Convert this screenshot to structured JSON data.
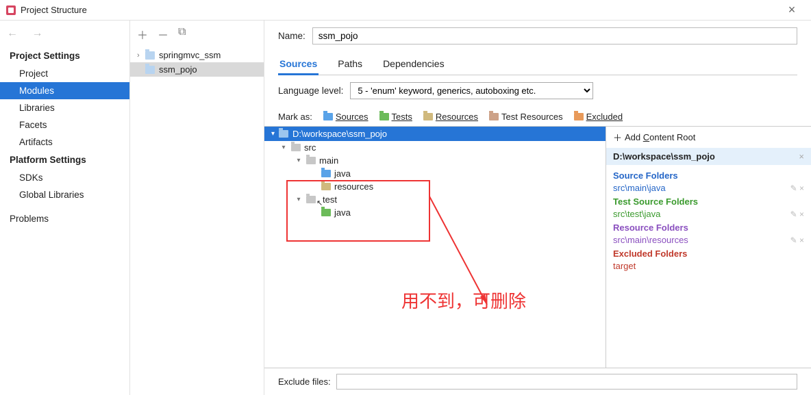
{
  "window": {
    "title": "Project Structure"
  },
  "nav": {
    "project_settings": "Project Settings",
    "items1": [
      "Project",
      "Modules",
      "Libraries",
      "Facets",
      "Artifacts"
    ],
    "platform_settings": "Platform Settings",
    "items2": [
      "SDKs",
      "Global Libraries"
    ],
    "problems": "Problems"
  },
  "modules": {
    "list": [
      {
        "name": "springmvc_ssm",
        "expandable": true
      },
      {
        "name": "ssm_pojo",
        "expandable": false
      }
    ],
    "selected": "ssm_pojo"
  },
  "form": {
    "name_label": "Name:",
    "name_value": "ssm_pojo",
    "lang_label": "Language level:",
    "lang_value": "5 - 'enum' keyword, generics, autoboxing etc."
  },
  "tabs": {
    "items": [
      "Sources",
      "Paths",
      "Dependencies"
    ],
    "active": "Sources"
  },
  "markas": {
    "label": "Mark as:",
    "sources": "Sources",
    "tests": "Tests",
    "resources": "Resources",
    "test_resources": "Test Resources",
    "excluded": "Excluded"
  },
  "tree": {
    "root": "D:\\workspace\\ssm_pojo",
    "src": "src",
    "main": "main",
    "main_java": "java",
    "main_resources": "resources",
    "test": "test",
    "test_java": "java"
  },
  "roots": {
    "add": "Add Content Root",
    "content_root": "D:\\workspace\\ssm_pojo",
    "source_title": "Source Folders",
    "source_entry": "src\\main\\java",
    "test_title": "Test Source Folders",
    "test_entry": "src\\test\\java",
    "resource_title": "Resource Folders",
    "resource_entry": "src\\main\\resources",
    "excluded_title": "Excluded Folders",
    "excluded_entry": "target"
  },
  "exclude": {
    "label": "Exclude files:",
    "value": ""
  },
  "annotation": {
    "text": "用不到，可删除"
  }
}
